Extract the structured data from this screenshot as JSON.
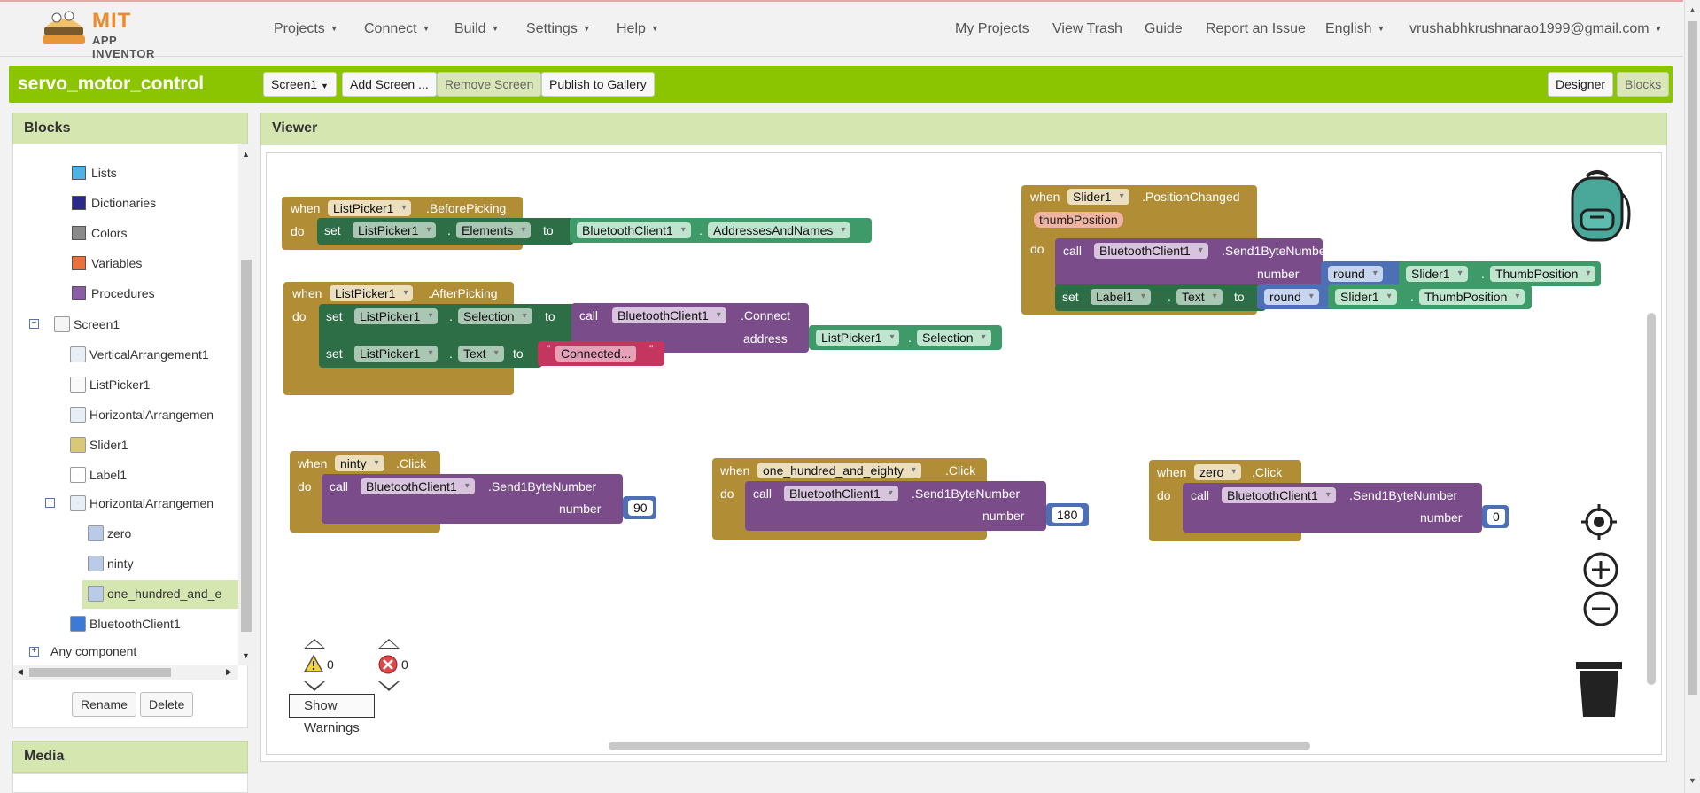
{
  "header": {
    "logo_mit": "MIT",
    "logo_app": "APP INVENTOR",
    "menus": [
      "Projects",
      "Connect",
      "Build",
      "Settings",
      "Help"
    ],
    "right_links": [
      "My Projects",
      "View Trash",
      "Guide",
      "Report an Issue"
    ],
    "language": "English",
    "account": "vrushabhkrushnarao1999@gmail.com"
  },
  "project": {
    "title": "servo_motor_control",
    "screen_select": "Screen1",
    "add_screen": "Add Screen ...",
    "remove_screen": "Remove Screen",
    "publish": "Publish to Gallery",
    "designer": "Designer",
    "blocks": "Blocks"
  },
  "blocks_panel": {
    "title": "Blocks",
    "builtin": [
      {
        "label": "Lists",
        "color": "#4db3e6"
      },
      {
        "label": "Dictionaries",
        "color": "#2b2a8a"
      },
      {
        "label": "Colors",
        "color": "#8a8a8a"
      },
      {
        "label": "Variables",
        "color": "#e8733a"
      },
      {
        "label": "Procedures",
        "color": "#8a5ea6"
      }
    ],
    "screen": "Screen1",
    "components": [
      "VerticalArrangement1",
      "ListPicker1",
      "HorizontalArrangemen",
      "Slider1",
      "Label1",
      "HorizontalArrangemen"
    ],
    "nested": [
      "zero",
      "ninty",
      "one_hundred_and_e"
    ],
    "bluetooth": "BluetoothClient1",
    "any_component": "Any component",
    "rename": "Rename",
    "delete": "Delete"
  },
  "media_panel": {
    "title": "Media"
  },
  "viewer": {
    "title": "Viewer",
    "kw": {
      "when": "when",
      "do": "do",
      "set": "set",
      "call": "call",
      "to": "to",
      "number": "number",
      "address": "address"
    },
    "b1": {
      "comp": "ListPicker1",
      "event": ".BeforePicking",
      "setcomp": "ListPicker1",
      "prop": "Elements",
      "src": "BluetoothClient1",
      "srcprop": "AddressesAndNames"
    },
    "b2": {
      "comp": "ListPicker1",
      "event": ".AfterPicking",
      "setcomp": "ListPicker1",
      "prop": "Selection",
      "callcomp": "BluetoothClient1",
      "method": ".Connect",
      "argcomp": "ListPicker1",
      "argprop": "Selection",
      "setcomp2": "ListPicker1",
      "prop2": "Text",
      "text": "Connected..."
    },
    "b3": {
      "comp": "Slider1",
      "event": ".PositionChanged",
      "param": "thumbPosition",
      "callcomp": "BluetoothClient1",
      "method": ".Send1ByteNumber",
      "round": "round",
      "argcomp": "Slider1",
      "argprop": "ThumbPosition",
      "setcomp": "Label1",
      "prop": "Text",
      "round2": "round",
      "argcomp2": "Slider1",
      "argprop2": "ThumbPosition"
    },
    "b4": {
      "comp": "ninty",
      "event": ".Click",
      "callcomp": "BluetoothClient1",
      "method": ".Send1ByteNumber",
      "value": "90"
    },
    "b5": {
      "comp": "one_hundred_and_eighty",
      "event": ".Click",
      "callcomp": "BluetoothClient1",
      "method": ".Send1ByteNumber",
      "value": "180"
    },
    "b6": {
      "comp": "zero",
      "event": ".Click",
      "callcomp": "BluetoothClient1",
      "method": ".Send1ByteNumber",
      "value": "0"
    },
    "warnings": {
      "warn_count": "0",
      "error_count": "0",
      "show_warnings": "Show Warnings"
    }
  }
}
